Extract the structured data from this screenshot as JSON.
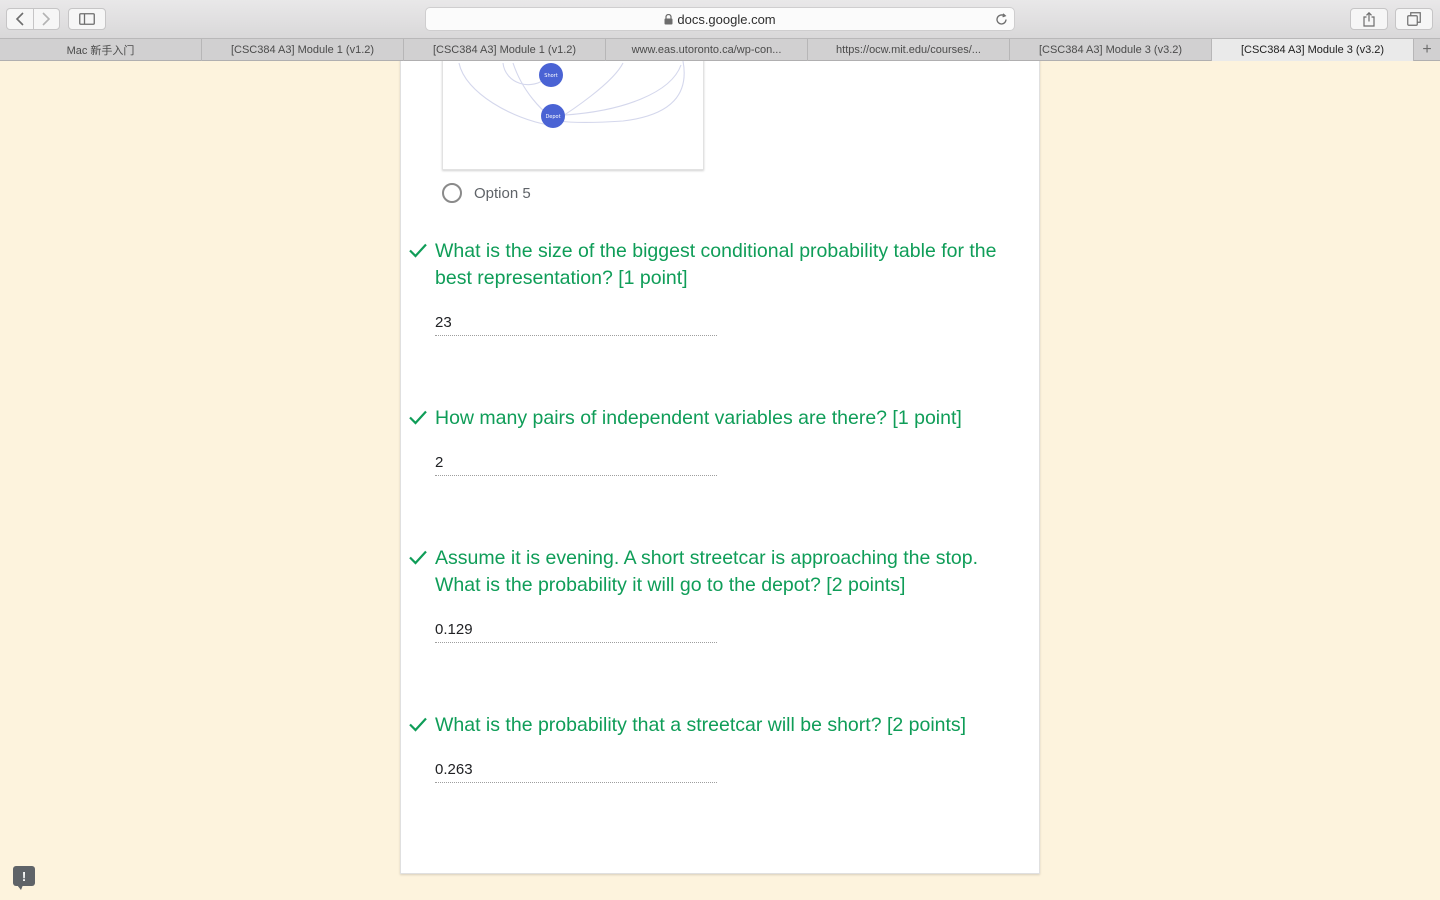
{
  "browser": {
    "url": "docs.google.com",
    "tabs": [
      {
        "label": "Mac 新手入门",
        "active": false
      },
      {
        "label": "[CSC384 A3] Module 1 (v1.2)",
        "active": false
      },
      {
        "label": "[CSC384 A3] Module 1 (v1.2)",
        "active": false
      },
      {
        "label": "www.eas.utoronto.ca/wp-con...",
        "active": false
      },
      {
        "label": "https://ocw.mit.edu/courses/...",
        "active": false
      },
      {
        "label": "[CSC384 A3] Module 3 (v3.2)",
        "active": false
      },
      {
        "label": "[CSC384 A3] Module 3 (v3.2)",
        "active": true
      }
    ],
    "new_tab_label": "+"
  },
  "diagram": {
    "nodes": [
      {
        "label": "Short"
      },
      {
        "label": "Depot"
      }
    ]
  },
  "option": {
    "label": "Option 5"
  },
  "questions": [
    {
      "text": "What is the size of the biggest conditional probability table for the best representation? [1 point]",
      "answer": "23"
    },
    {
      "text": "How many pairs of independent variables are there? [1 point]",
      "answer": "2"
    },
    {
      "text": "Assume it is evening. A short streetcar is approaching the stop. What is the probability it will go to the depot? [2 points]",
      "answer": "0.129"
    },
    {
      "text": "What is the probability that a streetcar will be short? [2 points]",
      "answer": "0.263"
    }
  ],
  "colors": {
    "page_background": "#fdf3dd",
    "correct_green": "#0f9d58",
    "node_blue": "#4a63d4"
  },
  "feedback_button": {
    "label": "!"
  }
}
